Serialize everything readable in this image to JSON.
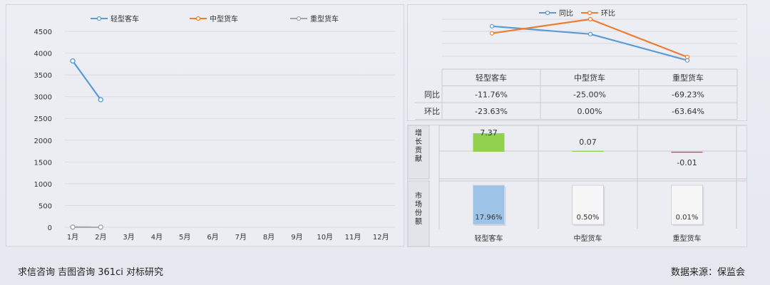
{
  "footer": {
    "left": "求信咨询 吉图咨询 361ci 对标研究",
    "right": "数据来源：保监会"
  },
  "colors": {
    "blue": "#5b9bd5",
    "orange": "#ed7d31",
    "gray": "#a5a5a5",
    "green": "#92d050",
    "red": "#e0332f",
    "lightblue": "#9dc3e6",
    "white": "#f6f6f6"
  },
  "chart_data": [
    {
      "type": "line",
      "categories": [
        "1月",
        "2月",
        "3月",
        "4月",
        "5月",
        "6月",
        "7月",
        "8月",
        "9月",
        "10月",
        "11月",
        "12月"
      ],
      "series": [
        {
          "name": "轻型客车",
          "values": [
            3820,
            2930,
            null,
            null,
            null,
            null,
            null,
            null,
            null,
            null,
            null,
            null
          ]
        },
        {
          "name": "中型货车",
          "values": [
            null,
            null,
            null,
            null,
            null,
            null,
            null,
            null,
            null,
            null,
            null,
            null
          ]
        },
        {
          "name": "重型货车",
          "values": [
            4,
            3,
            null,
            null,
            null,
            null,
            null,
            null,
            null,
            null,
            null,
            null
          ]
        }
      ],
      "yticks": [
        0,
        500,
        1000,
        1500,
        2000,
        2500,
        3000,
        3500,
        4000,
        4500
      ],
      "ylim": [
        0,
        4500
      ],
      "legend": "top",
      "grid": true
    },
    {
      "type": "line",
      "categories": [
        "轻型客车",
        "中型货车",
        "重型货车"
      ],
      "series": [
        {
          "name": "同比",
          "values": [
            -11.76,
            -25.0,
            -69.23
          ]
        },
        {
          "name": "环比",
          "values": [
            -23.63,
            0.0,
            -63.64
          ]
        }
      ],
      "legend": "top"
    },
    {
      "type": "table",
      "columns": [
        "轻型客车",
        "中型货车",
        "重型货车"
      ],
      "rows": [
        {
          "label": "同比",
          "values": [
            "-11.76%",
            "-25.00%",
            "-69.23%"
          ]
        },
        {
          "label": "环比",
          "values": [
            "-23.63%",
            "0.00%",
            "-63.64%"
          ]
        }
      ]
    },
    {
      "type": "bar",
      "name": "增长贡献",
      "row_label": "增长贡献",
      "categories": [
        "轻型客车",
        "中型货车",
        "重型货车"
      ],
      "values": [
        7.37,
        0.07,
        -0.01
      ],
      "labels": [
        "7.37",
        "0.07",
        "-0.01"
      ]
    },
    {
      "type": "bar",
      "name": "市场份额",
      "row_label": "市场份额",
      "categories": [
        "轻型客车",
        "中型货车",
        "重型货车"
      ],
      "values": [
        17.96,
        0.5,
        0.01
      ],
      "labels": [
        "17.96%",
        "0.50%",
        "0.01%"
      ]
    }
  ]
}
